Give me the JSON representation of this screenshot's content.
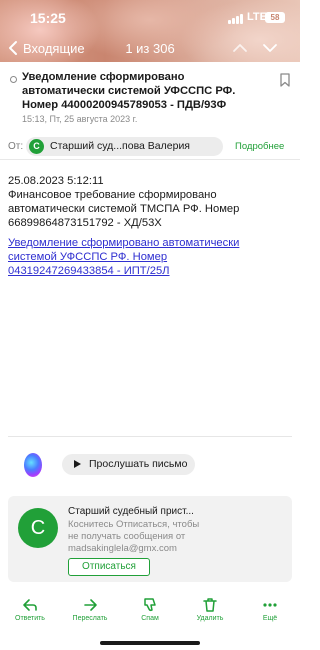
{
  "status_bar": {
    "time": "15:25",
    "network": "LTE",
    "battery": "58"
  },
  "nav": {
    "back_label": "Входящие",
    "counter": "1 из 306"
  },
  "message": {
    "subject": "Уведомление сформировано автоматически системой УФССПС РФ. Номер 44000200945789053 - ПДВ/93Ф",
    "date": "15:13, Пт, 25 августа 2023 г.",
    "from_label": "От:",
    "sender_initial": "С",
    "sender_name": "Старший суд...пова Валерия",
    "details_label": "Подробнее",
    "body_lines": [
      "25.08.2023 5:12:11",
      "Финансовое требование сформировано",
      "автоматически системой ТМСПА РФ. Номер",
      "66899864873151792 - ХД/53Х"
    ],
    "link_lines": [
      "Уведомление сформировано автоматически",
      "системой УФССПС РФ. Номер",
      "04319247269433854 - ИПТ/25Л"
    ]
  },
  "listen": {
    "label": "Прослушать письмо"
  },
  "unsubscribe_card": {
    "avatar_initial": "С",
    "title": "Старший судебный прист...",
    "text_lines": [
      "Коснитесь Отписаться, чтобы",
      "не получать сообщения от",
      "madsakinglela@gmx.com"
    ],
    "button_label": "Отписаться"
  },
  "toolbar": {
    "reply": "Ответить",
    "forward": "Переслать",
    "spam": "Спам",
    "delete": "Удалить",
    "more": "Ещё"
  },
  "colors": {
    "accent": "#21a038",
    "link": "#2f2fd0"
  }
}
